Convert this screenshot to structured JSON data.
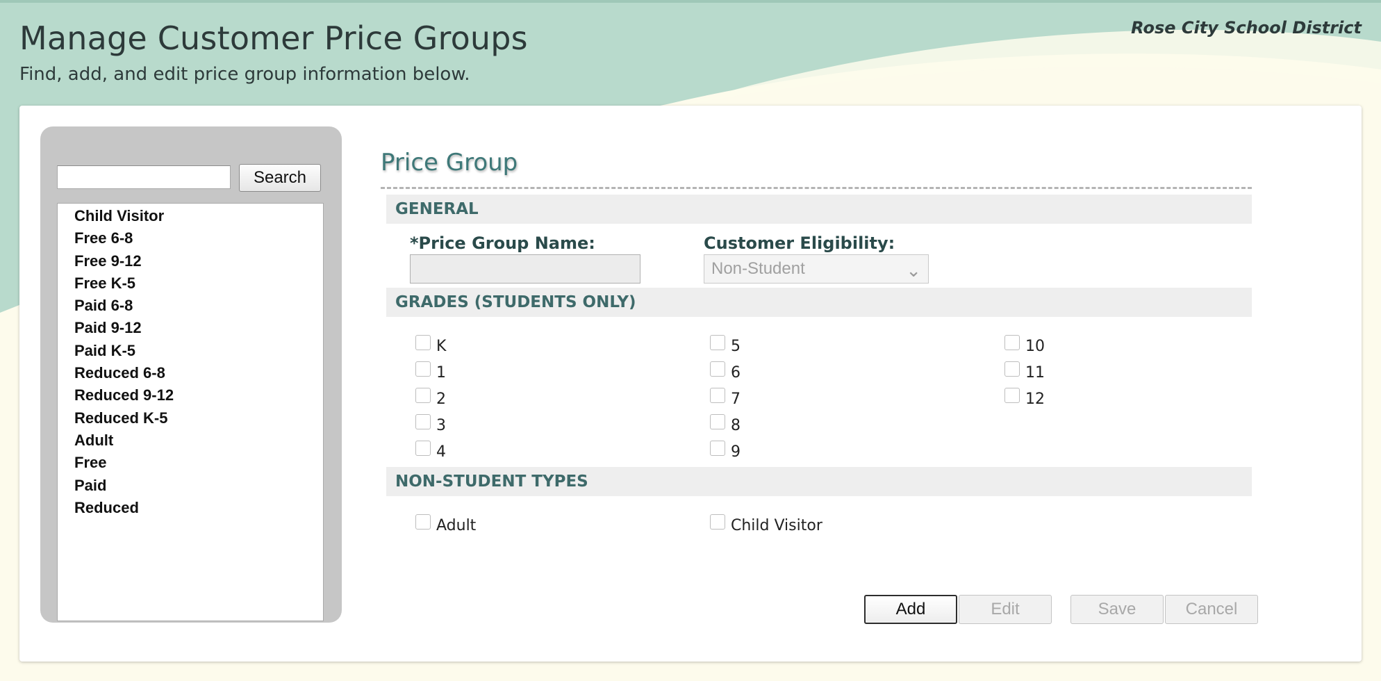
{
  "header": {
    "title": "Manage Customer Price Groups",
    "subtitle": "Find, add, and edit price group information below.",
    "district": "Rose City School District"
  },
  "colors": {
    "header_wave": "#b8dacc",
    "page_background": "#fdfbec",
    "section_title": "#3e7878",
    "band_background": "#eeeeee",
    "band_text": "#3e6a6a",
    "side_panel": "#c6c6c6"
  },
  "sidebar": {
    "search_value": "",
    "search_button": "Search",
    "items": [
      "Child Visitor",
      "Free 6-8",
      "Free 9-12",
      "Free K-5",
      "Paid 6-8",
      "Paid 9-12",
      "Paid K-5",
      "Reduced 6-8",
      "Reduced 9-12",
      "Reduced K-5",
      "Adult",
      "Free",
      "Paid",
      "Reduced"
    ]
  },
  "form": {
    "section_title": "Price Group",
    "general": {
      "heading": "GENERAL",
      "name_label": "*Price Group Name:",
      "name_value": "",
      "eligibility_label": "Customer Eligibility:",
      "eligibility_value": "Non-Student",
      "chevron_icon": "chevron-down-icon"
    },
    "grades": {
      "heading": "GRADES (STUDENTS ONLY)",
      "items": [
        "K",
        "1",
        "2",
        "3",
        "4",
        "5",
        "6",
        "7",
        "8",
        "9",
        "10",
        "11",
        "12"
      ],
      "checked": []
    },
    "non_student": {
      "heading": "NON-STUDENT TYPES",
      "items": [
        "Adult",
        "Child Visitor"
      ],
      "checked": []
    }
  },
  "actions": {
    "add": "Add",
    "edit": "Edit",
    "save": "Save",
    "cancel": "Cancel",
    "enabled": [
      "Add"
    ]
  }
}
